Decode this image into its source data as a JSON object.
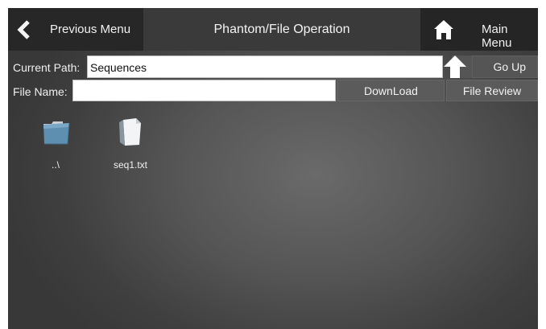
{
  "header": {
    "back_icon": "chevron-left-icon",
    "previous_label": "Previous Menu",
    "title": "Phantom/File Operation",
    "home_icon": "home-icon",
    "main_label": "Main Menu"
  },
  "path_row": {
    "label": "Current Path:",
    "value": "Sequences",
    "up_icon": "arrow-up-icon",
    "go_up_label": "Go Up"
  },
  "file_row": {
    "label": "File Name:",
    "value": "",
    "download_label": "DownLoad",
    "review_label": "File Review"
  },
  "files": [
    {
      "name": "..\\",
      "icon": "folder-icon"
    },
    {
      "name": "seq1.txt",
      "icon": "document-icon"
    }
  ],
  "colors": {
    "header_dark": "#272727",
    "header_mid": "#3a3a3a",
    "panel": "#555555",
    "text": "#f2f2f2"
  }
}
